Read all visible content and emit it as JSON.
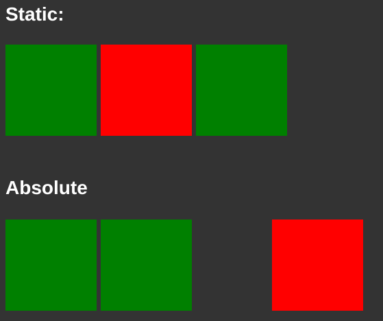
{
  "sections": {
    "static": {
      "heading": "Static:",
      "boxes": [
        "green",
        "red",
        "green"
      ]
    },
    "absolute": {
      "heading": "Absolute",
      "boxes": [
        "green",
        "green",
        "red"
      ]
    }
  },
  "colors": {
    "background": "#333333",
    "green": "#008000",
    "red": "#ff0000",
    "text": "#ffffff"
  }
}
